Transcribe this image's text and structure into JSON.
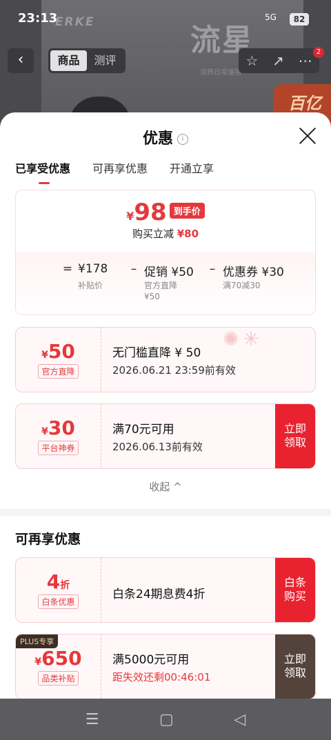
{
  "status": {
    "time": "23:13",
    "signal": "5G",
    "battery": "82"
  },
  "backdrop": {
    "brand": "ERKE",
    "title": "流星",
    "slogan": "涂鸦日常速搭",
    "promo": "百亿"
  },
  "topnav": {
    "back_glyph": "‹",
    "tabs": [
      "商品",
      "测评"
    ],
    "star_glyph": "☆",
    "share_glyph": "↗",
    "more_glyph": "⋯",
    "badge": "2"
  },
  "sheet": {
    "title": "优惠",
    "info_glyph": "i",
    "tabs": [
      "已享受优惠",
      "可再享优惠",
      "开通立享"
    ],
    "summary": {
      "currency": "¥",
      "final_price": "98",
      "final_tag": "到手价",
      "direct_label": "购买立减",
      "direct_amount": "¥80",
      "eq": "=",
      "minus": "–",
      "t1": "¥178",
      "t1_caption": "补贴价",
      "t2": "促销 ¥50",
      "t2_caption": "官方直降",
      "t2_caption2": "¥50",
      "t3": "优惠券 ¥30",
      "t3_caption": "满70减30"
    },
    "coupons": [
      {
        "currency": "¥",
        "amount": "50",
        "type": "官方直降",
        "line1": "无门槛直降 ¥ 50",
        "line2": "2026.06.21 23:59前有效"
      },
      {
        "currency": "¥",
        "amount": "30",
        "type": "平台神券",
        "line1": "满70元可用",
        "line2": "2026.06.13前有效",
        "action": [
          "立即",
          "领取"
        ]
      }
    ],
    "collapse_label": "收起",
    "collapse_glyph": "^",
    "more_title": "可再享优惠",
    "more_coupons": [
      {
        "amount": "4",
        "unit": "折",
        "type": "白条优惠",
        "line1": "白条24期息费4折",
        "action": [
          "白条",
          "购买"
        ]
      },
      {
        "tag": "PLUS专享",
        "currency": "¥",
        "amount": "650",
        "type": "品类补贴",
        "line1": "满5000元可用",
        "line2": "距失效还剩00:46:01",
        "action": [
          "立即",
          "领取"
        ]
      }
    ]
  },
  "navbar": {
    "menu_glyph": "☰",
    "home_glyph": "▢",
    "back_glyph": "◁"
  }
}
